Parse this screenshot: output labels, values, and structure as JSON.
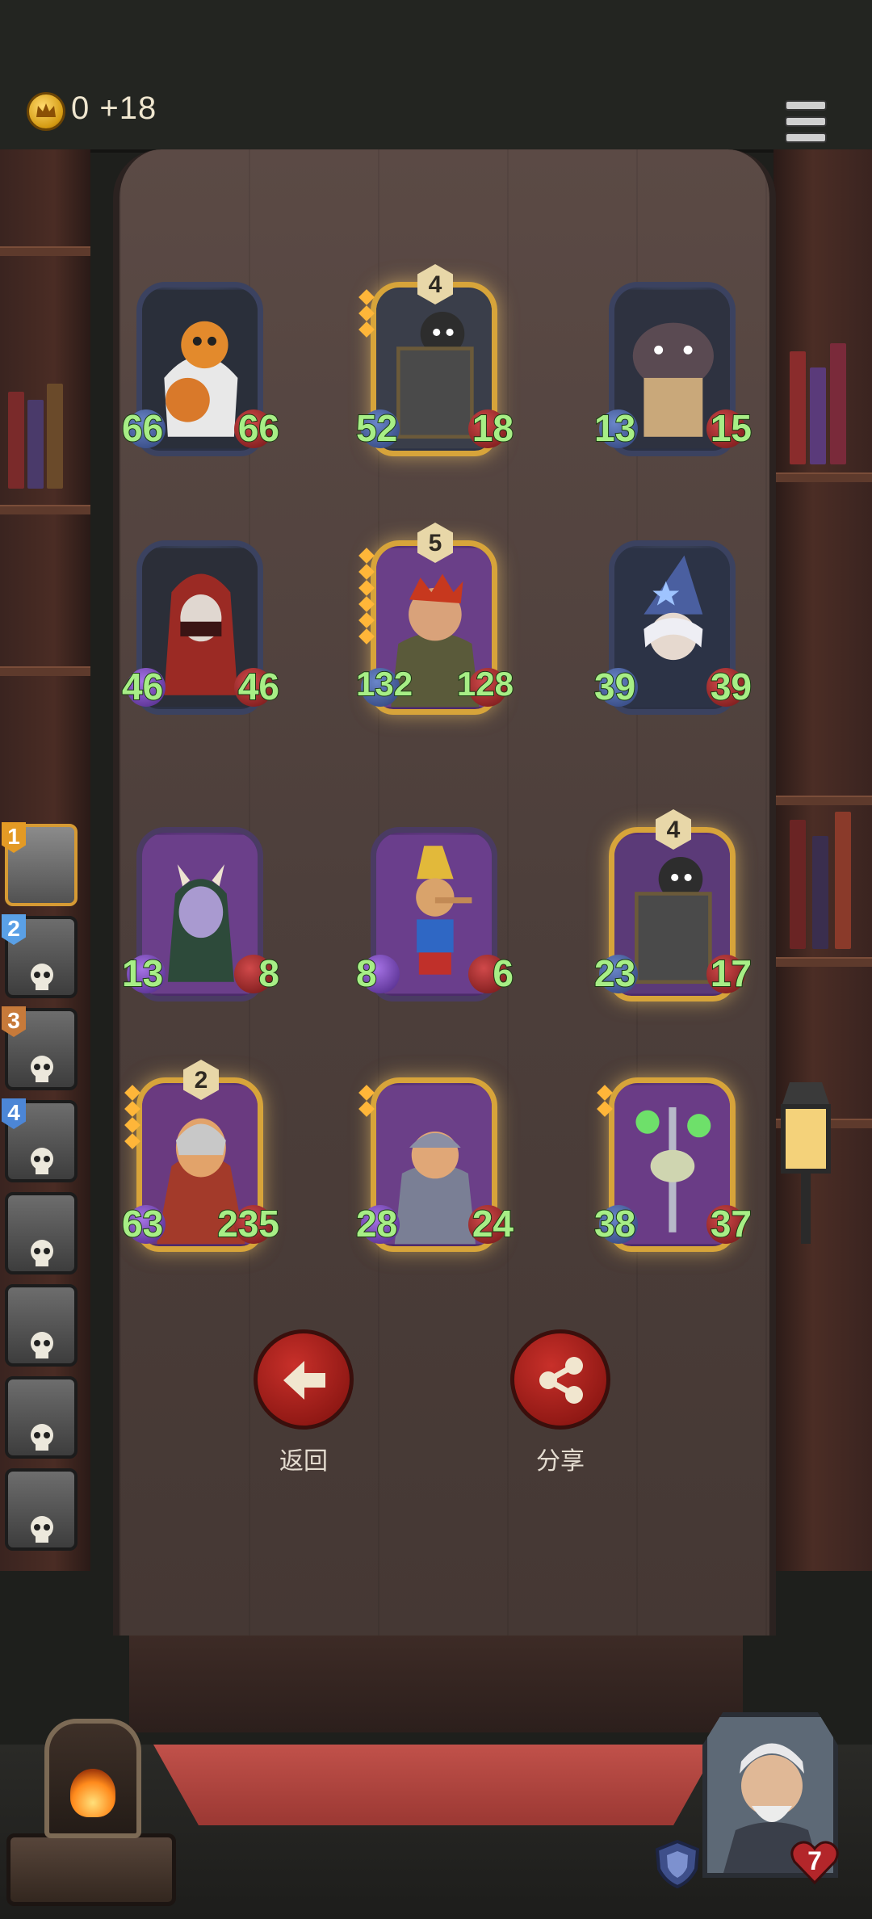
{
  "hud": {
    "gold_text": "0 +18",
    "gold_icon": "crown-coin-icon",
    "menu_icon": "hamburger-menu-icon"
  },
  "cards": [
    {
      "name": "pumpkin-scarecrow",
      "tier": "",
      "attack": "66",
      "health": "66",
      "frame": "blue",
      "portrait": "pumpkin-scarecrow"
    },
    {
      "name": "shield-knight-a",
      "tier": "4",
      "attack": "52",
      "health": "18",
      "frame": "gold-blue",
      "portrait": "shield-knight"
    },
    {
      "name": "bandaged-bear",
      "tier": "",
      "attack": "13",
      "health": "15",
      "frame": "blue",
      "portrait": "bear"
    },
    {
      "name": "hooded-assassin",
      "tier": "",
      "attack": "46",
      "health": "46",
      "frame": "blue",
      "portrait": "assassin"
    },
    {
      "name": "red-haired-brute",
      "tier": "5",
      "attack": "132",
      "health": "128",
      "frame": "gold-purple",
      "portrait": "brute"
    },
    {
      "name": "star-wizard",
      "tier": "",
      "attack": "39",
      "health": "39",
      "frame": "blue",
      "portrait": "wizard"
    },
    {
      "name": "horned-demoness",
      "tier": "",
      "attack": "13",
      "health": "8",
      "frame": "purple",
      "portrait": "demoness"
    },
    {
      "name": "pinocchio",
      "tier": "",
      "attack": "8",
      "health": "6",
      "frame": "purple",
      "portrait": "pinocchio"
    },
    {
      "name": "shield-knight-b",
      "tier": "4",
      "attack": "23",
      "health": "17",
      "frame": "gold-purple",
      "portrait": "shield-knight"
    },
    {
      "name": "helmed-villain",
      "tier": "2",
      "attack": "63",
      "health": "235",
      "frame": "gold-purple",
      "portrait": "villain"
    },
    {
      "name": "armored-dwarf",
      "tier": "",
      "attack": "28",
      "health": "24",
      "frame": "gold-purple",
      "portrait": "dwarf"
    },
    {
      "name": "skeleton-sword",
      "tier": "",
      "attack": "38",
      "health": "37",
      "frame": "gold-purple",
      "portrait": "skeleton"
    }
  ],
  "bench": [
    {
      "rank": "1",
      "badge_color": "#e39a25",
      "active": true
    },
    {
      "rank": "2",
      "badge_color": "#5aa0e6",
      "active": false
    },
    {
      "rank": "3",
      "badge_color": "#c77a3a",
      "active": false
    },
    {
      "rank": "4",
      "badge_color": "#4c86d6",
      "active": false
    },
    {
      "rank": "",
      "badge_color": "",
      "active": false
    },
    {
      "rank": "",
      "badge_color": "",
      "active": false
    },
    {
      "rank": "",
      "badge_color": "",
      "active": false
    },
    {
      "rank": "",
      "badge_color": "",
      "active": false
    }
  ],
  "actions": {
    "back_label": "返回",
    "back_icon": "arrow-left-icon",
    "share_label": "分享",
    "share_icon": "share-icon"
  },
  "hero": {
    "health": "7",
    "health_icon": "heart-icon",
    "armor_icon": "shield-icon"
  },
  "colors": {
    "stat_green": "#a7ee86",
    "button_red": "#c8302a",
    "gold_frame": "#d7a43a"
  }
}
